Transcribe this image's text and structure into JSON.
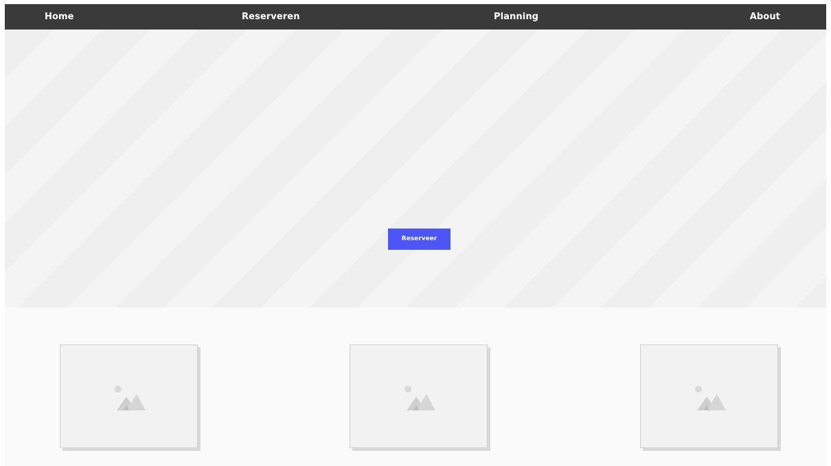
{
  "nav": {
    "items": [
      {
        "label": "Home"
      },
      {
        "label": "Reserveren"
      },
      {
        "label": "Planning"
      },
      {
        "label": "About"
      }
    ]
  },
  "hero": {
    "cta_label": "Reserveer",
    "cta_color": "#4c55f5"
  },
  "cards": [
    {
      "icon": "image-placeholder-icon"
    },
    {
      "icon": "image-placeholder-icon"
    },
    {
      "icon": "image-placeholder-icon"
    }
  ],
  "colors": {
    "navbar_bg": "#3a3a3a",
    "nav_text": "#ffffff"
  }
}
